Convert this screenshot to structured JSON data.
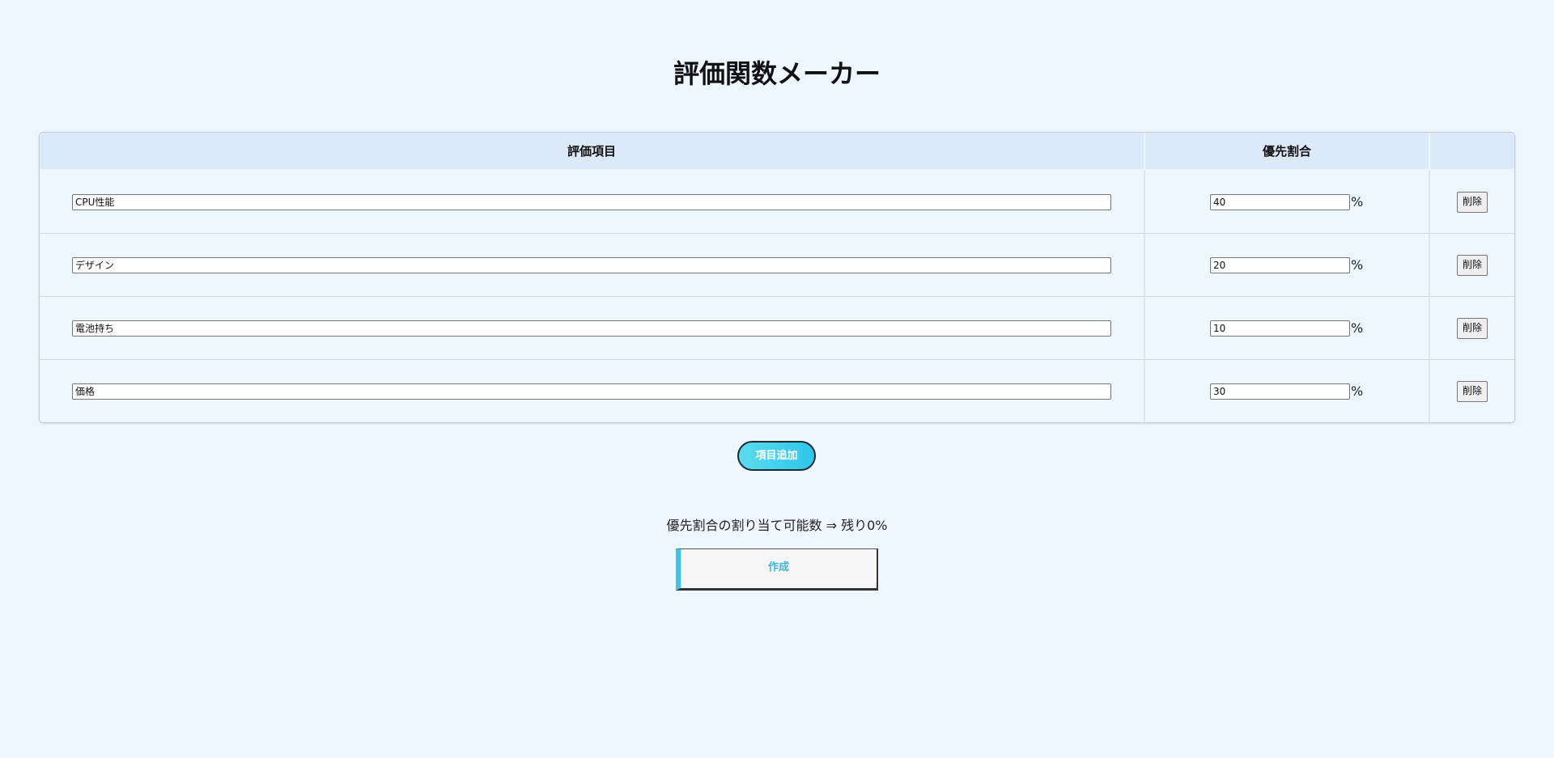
{
  "title": "評価関数メーカー",
  "table": {
    "headers": {
      "item": "評価項目",
      "priority": "優先割合",
      "action": ""
    },
    "rows": [
      {
        "name": "CPU性能",
        "percent": "40",
        "percent_sign": "%",
        "delete_label": "削除"
      },
      {
        "name": "デザイン",
        "percent": "20",
        "percent_sign": "%",
        "delete_label": "削除"
      },
      {
        "name": "電池持ち",
        "percent": "10",
        "percent_sign": "%",
        "delete_label": "削除"
      },
      {
        "name": "価格",
        "percent": "30",
        "percent_sign": "%",
        "delete_label": "削除"
      }
    ]
  },
  "add_button_label": "項目追加",
  "remaining_text": "優先割合の割り当て可能数 ⇒ 残り0%",
  "create_button_label": "作成",
  "colors": {
    "background": "#eef7ff",
    "header_bg": "#dbe9f8",
    "accent": "#3cc3e6"
  }
}
